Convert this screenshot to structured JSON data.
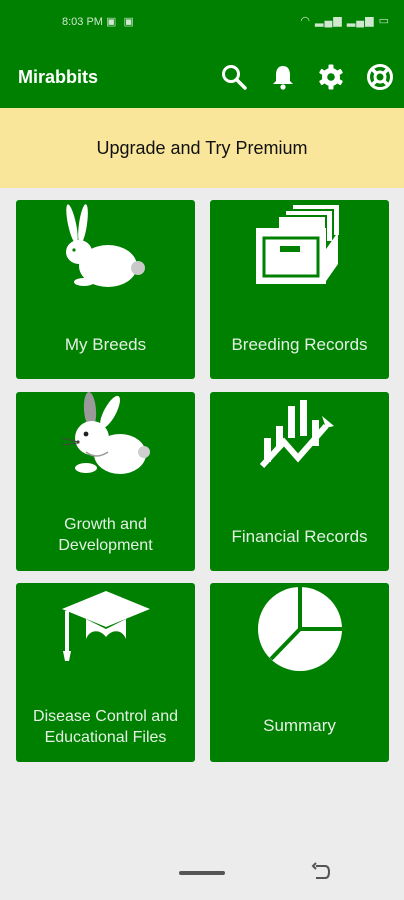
{
  "status_bar": {
    "time": "8:03 PM"
  },
  "app_bar": {
    "title": "Mirabbits",
    "icons": [
      "search-icon",
      "bell-icon",
      "gear-icon",
      "lifebuoy-icon"
    ]
  },
  "banner": {
    "label": "Upgrade and Try Premium"
  },
  "tiles": [
    {
      "label": "My Breeds",
      "icon": "rabbit-icon"
    },
    {
      "label": "Breeding Records",
      "icon": "file-box-icon"
    },
    {
      "label": "Growth and Development",
      "icon": "bunny-icon"
    },
    {
      "label": "Financial Records",
      "icon": "chart-trend-icon"
    },
    {
      "label": "Disease Control and Educational Files",
      "icon": "graduation-cap-icon"
    },
    {
      "label": "Summary",
      "icon": "pie-chart-icon"
    }
  ],
  "colors": {
    "primary": "#008000",
    "banner": "#fae69a",
    "background": "#ececec"
  }
}
